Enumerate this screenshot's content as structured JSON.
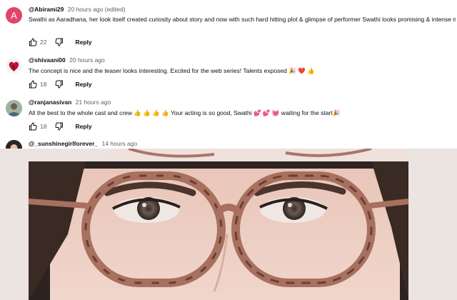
{
  "comments": [
    {
      "avatar_letter": "A",
      "handle": "@Abirami29",
      "meta": "20 hours ago (edited)",
      "text": "Swathi as Aaradhana, her look itself created curiosity about story  and now with such hard hitting plot & glimpse of performer Swathi looks promising & intense main picture!! Looking forward to the release 🤩",
      "likes": "22",
      "reply": "Reply"
    },
    {
      "handle": "@shivaani00",
      "meta": "20 hours ago",
      "text": "The concept is nice and the teaser looks interesting. Excited for the web series! Talents exposed 🎉 ❤️ 👍",
      "likes": "18",
      "reply": "Reply"
    },
    {
      "handle": "@ranjanasivan",
      "meta": "21 hours ago",
      "text": "All the best to the whole cast and crew 👍 👍 👍 👍  Your acting is so good, Swathi 💕 💕 💓  waiting for the start🎉",
      "likes": "18",
      "reply": "Reply"
    },
    {
      "handle": "@_sunshinegirlforever_",
      "meta": "14 hours ago"
    }
  ],
  "colors": {
    "avatar_accent": "#e0446b",
    "meta_gray": "#606060"
  },
  "icons": [
    "like-icon",
    "dislike-icon"
  ]
}
